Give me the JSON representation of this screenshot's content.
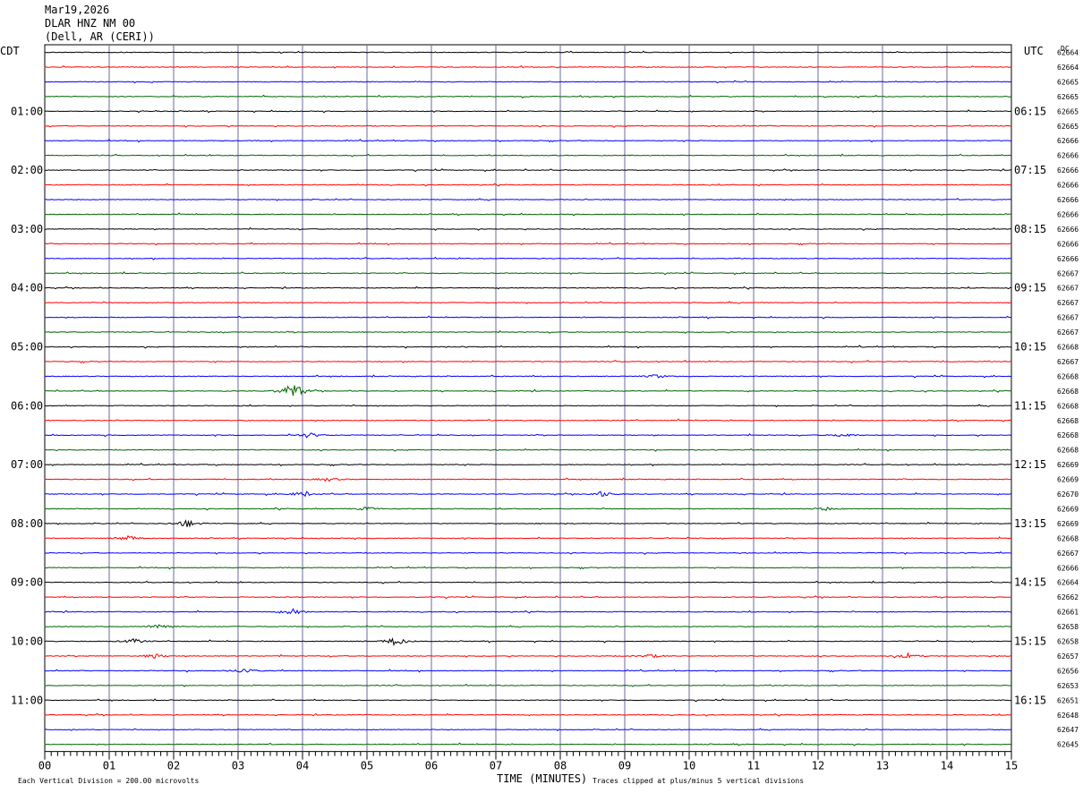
{
  "header": {
    "date": "Mar19,2026",
    "station": "DLAR HNZ NM 00",
    "location": "(Dell, AR (CERI))"
  },
  "left_axis_label": "CDT",
  "right_axis_label": "UTC",
  "dc_label": "DC",
  "footer": {
    "scale_note": "Each Vertical Division =  200.00 microvolts",
    "xlabel": "TIME (MINUTES)",
    "clip_note": "Traces clipped at plus/minus 5 vertical divisions"
  },
  "colors": {
    "trace_cycle": [
      "#000000",
      "#ff0000",
      "#0000ff",
      "#006400"
    ],
    "grid": "#6b6b9a"
  },
  "chart_data": {
    "type": "line",
    "title": "",
    "xlabel": "TIME (MINUTES)",
    "xlim": [
      0,
      15
    ],
    "x_tick_labels": [
      "00",
      "01",
      "02",
      "03",
      "04",
      "05",
      "06",
      "07",
      "08",
      "09",
      "10",
      "11",
      "12",
      "13",
      "14",
      "15"
    ],
    "left_time_labels": [
      "01:00",
      "02:00",
      "03:00",
      "04:00",
      "05:00",
      "06:00",
      "07:00",
      "08:00",
      "09:00",
      "10:00",
      "11:00"
    ],
    "right_time_labels": [
      "06:15",
      "07:15",
      "08:15",
      "09:15",
      "10:15",
      "11:15",
      "12:15",
      "13:15",
      "14:15",
      "15:15",
      "16:15"
    ],
    "dc_offsets": [
      "62664",
      "62664",
      "62665",
      "62665",
      "62665",
      "62665",
      "62666",
      "62666",
      "62666",
      "62666",
      "62666",
      "62666",
      "62666",
      "62666",
      "62666",
      "62667",
      "62667",
      "62667",
      "62667",
      "62667",
      "62668",
      "62667",
      "62668",
      "62668",
      "62668",
      "62668",
      "62668",
      "62668",
      "62669",
      "62669",
      "62670",
      "62669",
      "62669",
      "62668",
      "62667",
      "62666",
      "62664",
      "62662",
      "62661",
      "62658",
      "62658",
      "62657",
      "62656",
      "62653",
      "62651",
      "62648",
      "62647",
      "62645"
    ],
    "events": [
      {
        "trace": 23,
        "minute": 3.85,
        "amp": 5
      },
      {
        "trace": 22,
        "minute": 9.5,
        "amp": 1
      },
      {
        "trace": 26,
        "minute": 4.1,
        "amp": 1.5
      },
      {
        "trace": 26,
        "minute": 12.4,
        "amp": 1.2
      },
      {
        "trace": 29,
        "minute": 4.4,
        "amp": 1
      },
      {
        "trace": 30,
        "minute": 4.0,
        "amp": 1.5
      },
      {
        "trace": 30,
        "minute": 8.65,
        "amp": 1.5
      },
      {
        "trace": 31,
        "minute": 5.0,
        "amp": 1
      },
      {
        "trace": 31,
        "minute": 12.1,
        "amp": 1
      },
      {
        "trace": 32,
        "minute": 2.2,
        "amp": 2.2
      },
      {
        "trace": 33,
        "minute": 1.3,
        "amp": 1.5
      },
      {
        "trace": 38,
        "minute": 3.85,
        "amp": 1.5
      },
      {
        "trace": 39,
        "minute": 1.8,
        "amp": 2
      },
      {
        "trace": 40,
        "minute": 5.45,
        "amp": 2.5
      },
      {
        "trace": 40,
        "minute": 1.4,
        "amp": 1.3
      },
      {
        "trace": 41,
        "minute": 1.7,
        "amp": 1.3
      },
      {
        "trace": 41,
        "minute": 13.4,
        "amp": 1.3
      },
      {
        "trace": 41,
        "minute": 9.4,
        "amp": 1
      },
      {
        "trace": 42,
        "minute": 3.1,
        "amp": 1.3
      }
    ]
  }
}
